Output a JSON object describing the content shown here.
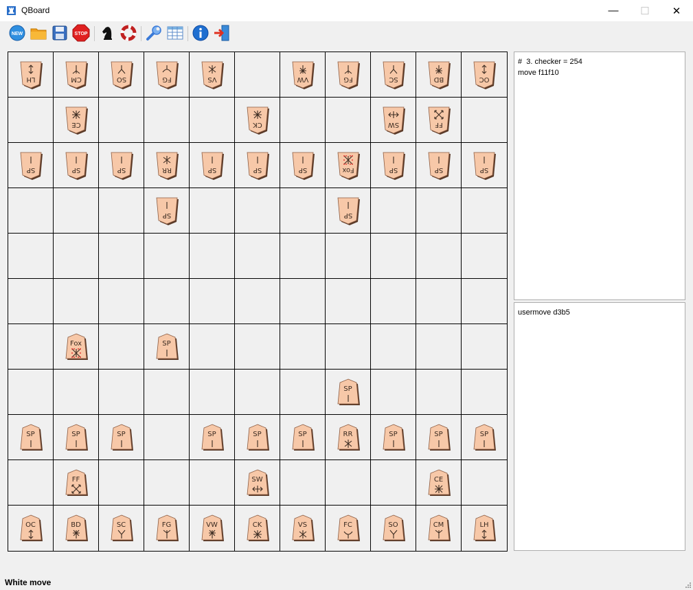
{
  "window": {
    "title": "QBoard",
    "controls": {
      "minimize": "—",
      "maximize": "☐",
      "close": "✕"
    }
  },
  "toolbar": {
    "buttons": [
      {
        "id": "new",
        "icon": "new-icon",
        "label": "NEW"
      },
      {
        "id": "open",
        "icon": "open-folder-icon"
      },
      {
        "id": "save",
        "icon": "save-disk-icon"
      },
      {
        "id": "stop",
        "icon": "stop-icon",
        "label": "STOP"
      },
      {
        "id": "engine",
        "icon": "knight-icon"
      },
      {
        "id": "flip",
        "icon": "rotate-icon"
      },
      {
        "id": "settings",
        "icon": "wrench-icon"
      },
      {
        "id": "table",
        "icon": "table-icon"
      },
      {
        "id": "about",
        "icon": "info-icon"
      },
      {
        "id": "exit",
        "icon": "exit-icon"
      }
    ]
  },
  "board": {
    "size": 11,
    "rows": [
      [
        [
          "LH",
          "down",
          "arrow2"
        ],
        [
          "CM",
          "down",
          "trident"
        ],
        [
          "SO",
          "down",
          "fork"
        ],
        [
          "FG",
          "down",
          "bow"
        ],
        [
          "VS",
          "down",
          "cross"
        ],
        null,
        [
          "VW",
          "down",
          "star"
        ],
        [
          "FG",
          "down",
          "trident"
        ],
        [
          "SC",
          "down",
          "fork"
        ],
        [
          "BD",
          "down",
          "star"
        ],
        [
          "OC",
          "down",
          "arrow2"
        ]
      ],
      [
        null,
        [
          "CE",
          "down",
          "snow"
        ],
        null,
        null,
        null,
        [
          "CK",
          "down",
          "snow"
        ],
        null,
        null,
        [
          "SW",
          "down",
          "side"
        ],
        [
          "FF",
          "down",
          "diag"
        ],
        null
      ],
      [
        [
          "SP",
          "down",
          "tick"
        ],
        [
          "SP",
          "down",
          "tick"
        ],
        [
          "SP",
          "down",
          "tick"
        ],
        [
          "RR",
          "down",
          "cross"
        ],
        [
          "SP",
          "down",
          "tick"
        ],
        [
          "SP",
          "down",
          "tick"
        ],
        [
          "SP",
          "down",
          "tick"
        ],
        [
          "Fox",
          "down",
          "fox"
        ],
        [
          "SP",
          "down",
          "tick"
        ],
        [
          "SP",
          "down",
          "tick"
        ],
        [
          "SP",
          "down",
          "tick"
        ]
      ],
      [
        null,
        null,
        null,
        [
          "SP",
          "down",
          "tick"
        ],
        null,
        null,
        null,
        [
          "SP",
          "down",
          "tick"
        ],
        null,
        null,
        null
      ],
      [
        null,
        null,
        null,
        null,
        null,
        null,
        null,
        null,
        null,
        null,
        null
      ],
      [
        null,
        null,
        null,
        null,
        null,
        null,
        null,
        null,
        null,
        null,
        null
      ],
      [
        null,
        [
          "Fox",
          "up",
          "fox"
        ],
        null,
        [
          "SP",
          "up",
          "tick"
        ],
        null,
        null,
        null,
        null,
        null,
        null,
        null
      ],
      [
        null,
        null,
        null,
        null,
        null,
        null,
        null,
        [
          "SP",
          "up",
          "tick"
        ],
        null,
        null,
        null
      ],
      [
        [
          "SP",
          "up",
          "tick"
        ],
        [
          "SP",
          "up",
          "tick"
        ],
        [
          "SP",
          "up",
          "tick"
        ],
        null,
        [
          "SP",
          "up",
          "tick"
        ],
        [
          "SP",
          "up",
          "tick"
        ],
        [
          "SP",
          "up",
          "tick"
        ],
        [
          "RR",
          "up",
          "cross"
        ],
        [
          "SP",
          "up",
          "tick"
        ],
        [
          "SP",
          "up",
          "tick"
        ],
        [
          "SP",
          "up",
          "tick"
        ]
      ],
      [
        null,
        [
          "FF",
          "up",
          "diag"
        ],
        null,
        null,
        null,
        [
          "SW",
          "up",
          "side"
        ],
        null,
        null,
        null,
        [
          "CE",
          "up",
          "snow"
        ],
        null
      ],
      [
        [
          "OC",
          "up",
          "arrow2"
        ],
        [
          "BD",
          "up",
          "star"
        ],
        [
          "SC",
          "up",
          "fork"
        ],
        [
          "FG",
          "up",
          "trident"
        ],
        [
          "VW",
          "up",
          "star"
        ],
        [
          "CK",
          "up",
          "snow"
        ],
        [
          "VS",
          "up",
          "cross"
        ],
        [
          "FC",
          "up",
          "bow"
        ],
        [
          "SO",
          "up",
          "fork"
        ],
        [
          "CM",
          "up",
          "trident"
        ],
        [
          "LH",
          "up",
          "arrow2"
        ]
      ]
    ]
  },
  "engine_output": {
    "lines": [
      "#  3. checker = 254",
      "move f11f10"
    ]
  },
  "user_input": {
    "lines": [
      "usermove d3b5"
    ]
  },
  "status": {
    "text": "White move"
  },
  "colors": {
    "piece_fill": "#f7c8a8",
    "piece_shadow": "#5a3a28",
    "fox_dots": "#e01010"
  }
}
